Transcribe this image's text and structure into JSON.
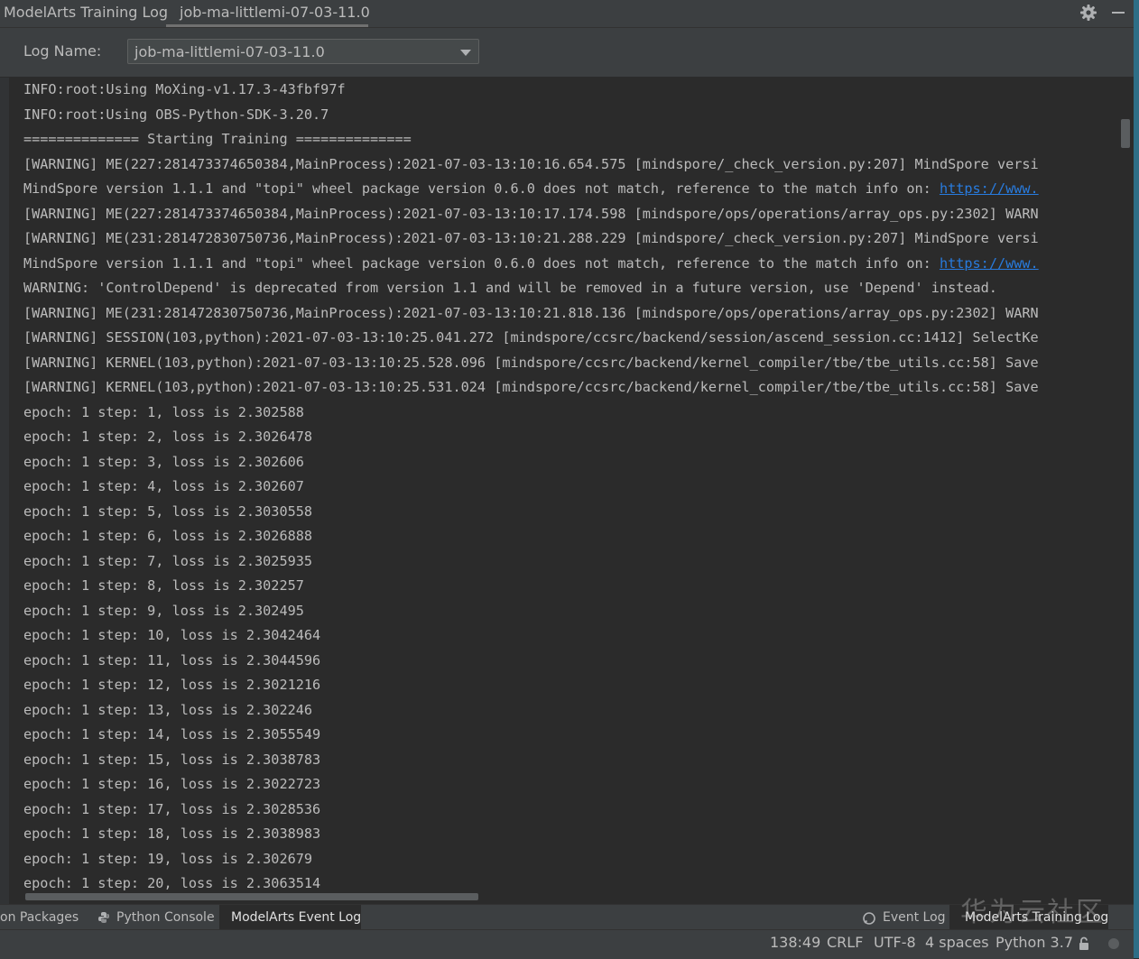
{
  "header": {
    "title": "ModelArts Training Log",
    "tab": "job-ma-littlemi-07-03-11.0",
    "settings_icon": "gear-icon",
    "hide_icon": "minus-icon"
  },
  "log_selector": {
    "label": "Log Name:",
    "value": "job-ma-littlemi-07-03-11.0"
  },
  "console": {
    "lines": [
      "INFO:root:Using MoXing-v1.17.3-43fbf97f",
      "INFO:root:Using OBS-Python-SDK-3.20.7",
      "============== Starting Training ==============",
      "[WARNING] ME(227:281473374650384,MainProcess):2021-07-03-13:10:16.654.575 [mindspore/_check_version.py:207] MindSpore versi",
      "MindSpore version 1.1.1 and \"topi\" wheel package version 0.6.0 does not match, reference to the match info on: ",
      "[WARNING] ME(227:281473374650384,MainProcess):2021-07-03-13:10:17.174.598 [mindspore/ops/operations/array_ops.py:2302] WARN",
      "[WARNING] ME(231:281472830750736,MainProcess):2021-07-03-13:10:21.288.229 [mindspore/_check_version.py:207] MindSpore versi",
      "MindSpore version 1.1.1 and \"topi\" wheel package version 0.6.0 does not match, reference to the match info on: ",
      "WARNING: 'ControlDepend' is deprecated from version 1.1 and will be removed in a future version, use 'Depend' instead.",
      "[WARNING] ME(231:281472830750736,MainProcess):2021-07-03-13:10:21.818.136 [mindspore/ops/operations/array_ops.py:2302] WARN",
      "[WARNING] SESSION(103,python):2021-07-03-13:10:25.041.272 [mindspore/ccsrc/backend/session/ascend_session.cc:1412] SelectKe",
      "[WARNING] KERNEL(103,python):2021-07-03-13:10:25.528.096 [mindspore/ccsrc/backend/kernel_compiler/tbe/tbe_utils.cc:58] Save",
      "[WARNING] KERNEL(103,python):2021-07-03-13:10:25.531.024 [mindspore/ccsrc/backend/kernel_compiler/tbe/tbe_utils.cc:58] Save",
      "epoch: 1 step: 1, loss is 2.302588",
      "epoch: 1 step: 2, loss is 2.3026478",
      "epoch: 1 step: 3, loss is 2.302606",
      "epoch: 1 step: 4, loss is 2.302607",
      "epoch: 1 step: 5, loss is 2.3030558",
      "epoch: 1 step: 6, loss is 2.3026888",
      "epoch: 1 step: 7, loss is 2.3025935",
      "epoch: 1 step: 8, loss is 2.302257",
      "epoch: 1 step: 9, loss is 2.302495",
      "epoch: 1 step: 10, loss is 2.3042464",
      "epoch: 1 step: 11, loss is 2.3044596",
      "epoch: 1 step: 12, loss is 2.3021216",
      "epoch: 1 step: 13, loss is 2.302246",
      "epoch: 1 step: 14, loss is 2.3055549",
      "epoch: 1 step: 15, loss is 2.3038783",
      "epoch: 1 step: 16, loss is 2.3022723",
      "epoch: 1 step: 17, loss is 2.3028536",
      "epoch: 1 step: 18, loss is 2.3038983",
      "epoch: 1 step: 19, loss is 2.302679",
      "epoch: 1 step: 20, loss is 2.3063514"
    ],
    "link_text": "https://www."
  },
  "tool_windows": {
    "packages": "on Packages",
    "python_console": "Python Console",
    "event_log_modelarts": "ModelArts Event Log",
    "event_log": "Event Log",
    "training_log": "ModelArts Training Log"
  },
  "status_bar": {
    "position": "138:49",
    "line_sep": "CRLF",
    "encoding": "UTF-8",
    "indent": "4 spaces",
    "interpreter": "Python 3.7"
  },
  "watermark": "华为云社区",
  "colors": {
    "panel": "#3c3f41",
    "editor": "#2b2b2b",
    "text": "#bbbbbb",
    "link": "#287bde"
  }
}
